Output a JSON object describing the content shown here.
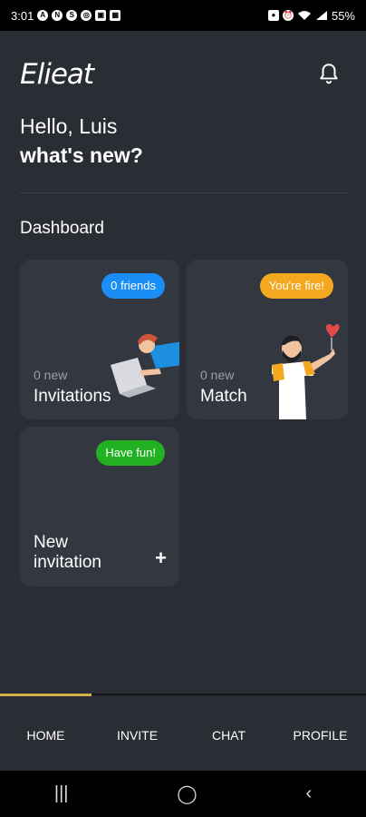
{
  "status_bar": {
    "time": "3:01",
    "battery": "55%"
  },
  "header": {
    "logo": "Elieat"
  },
  "greeting": {
    "line1": "Hello, Luis",
    "line2": "what's new?"
  },
  "dashboard": {
    "title": "Dashboard",
    "cards": {
      "invitations": {
        "badge": "0 friends",
        "count": "0 new",
        "title": "Invitations"
      },
      "match": {
        "badge": "You're fire!",
        "count": "0 new",
        "title": "Match"
      },
      "new_invitation": {
        "badge": "Have fun!",
        "title_line1": "New",
        "title_line2": "invitation",
        "action": "+"
      }
    }
  },
  "bottom_nav": {
    "items": [
      "HOME",
      "INVITE",
      "CHAT",
      "PROFILE"
    ],
    "active": "HOME"
  },
  "colors": {
    "background": "#2a2d33",
    "card": "#333740",
    "accent_gold": "#d4b04a",
    "badge_blue": "#1b8df7",
    "badge_orange": "#f4a81f",
    "badge_green": "#22b122"
  }
}
